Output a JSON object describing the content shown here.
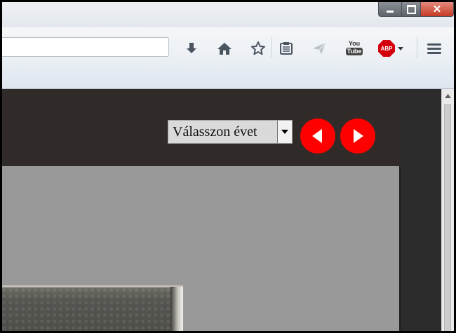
{
  "window": {
    "minimize_label": "",
    "maximize_label": "",
    "close_label": "✕"
  },
  "toolbar": {
    "url_value": "",
    "icons": [
      "download-icon",
      "home-icon",
      "bookmark-star-icon",
      "reading-list-icon",
      "send-icon",
      "youtube-icon",
      "adblock-plus-icon",
      "menu-icon"
    ],
    "youtube_top": "You",
    "youtube_bottom": "Tube",
    "abp_label": "ABP"
  },
  "page": {
    "year_select": {
      "selected": "Válasszon évet"
    },
    "accent_color": "#ff0000"
  }
}
